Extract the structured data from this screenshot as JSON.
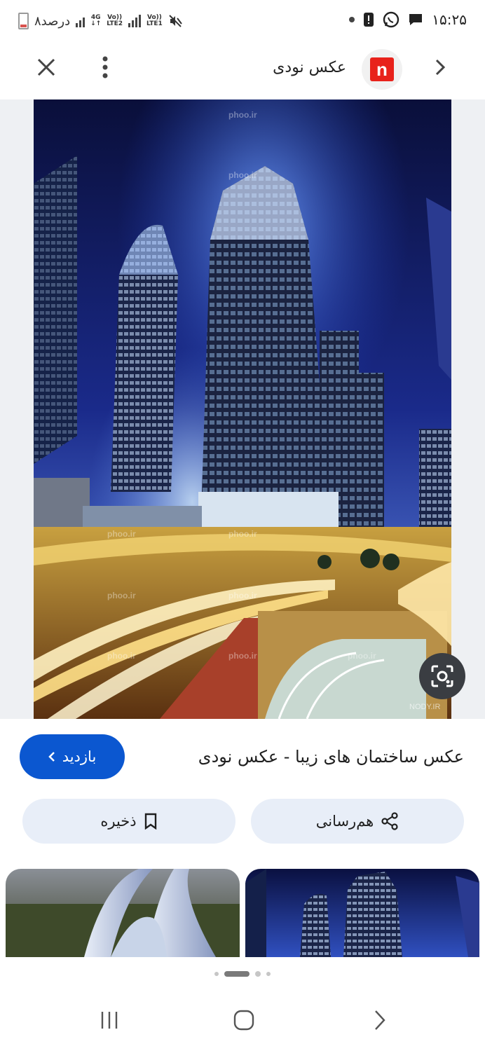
{
  "status_bar": {
    "time": "۱۵:۲۵",
    "battery_text": "۸درصد",
    "lte1": "LTE1",
    "lte2": "LTE2",
    "volte": "Vo))",
    "network": "4G"
  },
  "top_bar": {
    "site_name": "عکس نودی",
    "logo_letter": "n"
  },
  "image": {
    "watermark": "phoo.ir",
    "corner_watermark": "NODY.IR"
  },
  "result": {
    "title": "عکس ساختمان های زیبا - عکس نودی",
    "visit_label": "بازدید"
  },
  "actions": {
    "save_label": "ذخیره",
    "share_label": "هم‌رسانی"
  },
  "colors": {
    "accent": "#0b57d0",
    "pill_bg": "#e8eef8",
    "logo_red": "#e8221b"
  },
  "icons": [
    "close-icon",
    "more-vert-icon",
    "back-chevron-icon",
    "lens-icon",
    "bookmark-icon",
    "share-icon",
    "recents-icon",
    "home-icon",
    "nav-back-icon"
  ]
}
